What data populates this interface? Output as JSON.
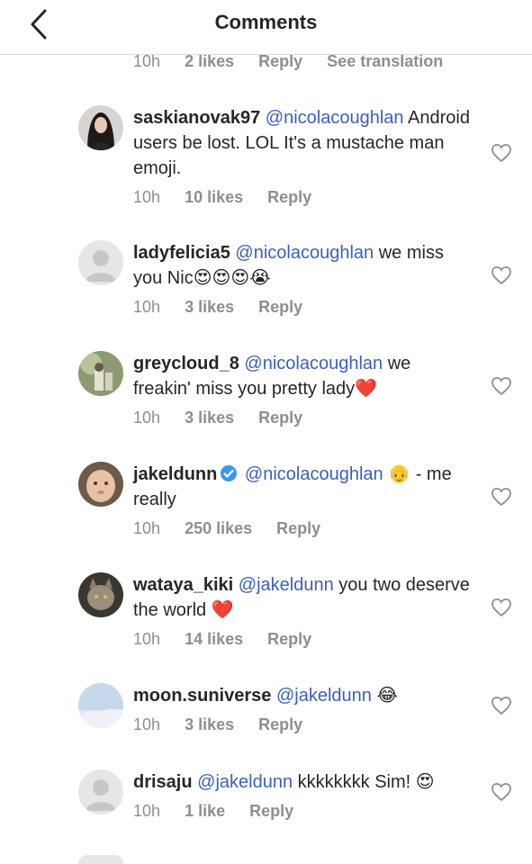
{
  "header": {
    "title": "Comments"
  },
  "top_meta": {
    "time": "10h",
    "likes": "2 likes",
    "reply": "Reply",
    "translate": "See translation"
  },
  "comments": [
    {
      "username": "saskianovak97",
      "mention": "@nicolacoughlan",
      "text": " Android users be lost. LOL It's a mustache man emoji.",
      "emoji": "",
      "time": "10h",
      "likes": "10 likes",
      "reply": "Reply"
    },
    {
      "username": "ladyfelicia5",
      "mention": "@nicolacoughlan",
      "text": " we miss you Nic",
      "emoji": "😍😍😍😭",
      "time": "10h",
      "likes": "3 likes",
      "reply": "Reply"
    },
    {
      "username": "greycloud_8",
      "mention": "@nicolacoughlan",
      "text": " we freakin' miss you pretty lady",
      "emoji": "❤️",
      "time": "10h",
      "likes": "3 likes",
      "reply": "Reply"
    },
    {
      "username": "jakeldunn",
      "mention": "@nicolacoughlan",
      "text": " - me really",
      "emoji": "👴",
      "time": "10h",
      "likes": "250 likes",
      "reply": "Reply"
    },
    {
      "username": "wataya_kiki",
      "mention": "@jakeldunn",
      "text": " you two deserve the world",
      "emoji": "❤️",
      "time": "10h",
      "likes": "14 likes",
      "reply": "Reply"
    },
    {
      "username": "moon.suniverse",
      "mention": "@jakeldunn",
      "text": " ",
      "emoji": "😂",
      "time": "10h",
      "likes": "3 likes",
      "reply": "Reply"
    },
    {
      "username": "drisaju",
      "mention": "@jakeldunn",
      "text": " kkkkkkkk Sim! ",
      "emoji": "😍",
      "time": "10h",
      "likes": "1 like",
      "reply": "Reply"
    }
  ],
  "colors": {
    "mention": "#3b5fc0",
    "meta": "#8e8e8e",
    "text": "#262626",
    "heart_red": "#ed2d55"
  }
}
